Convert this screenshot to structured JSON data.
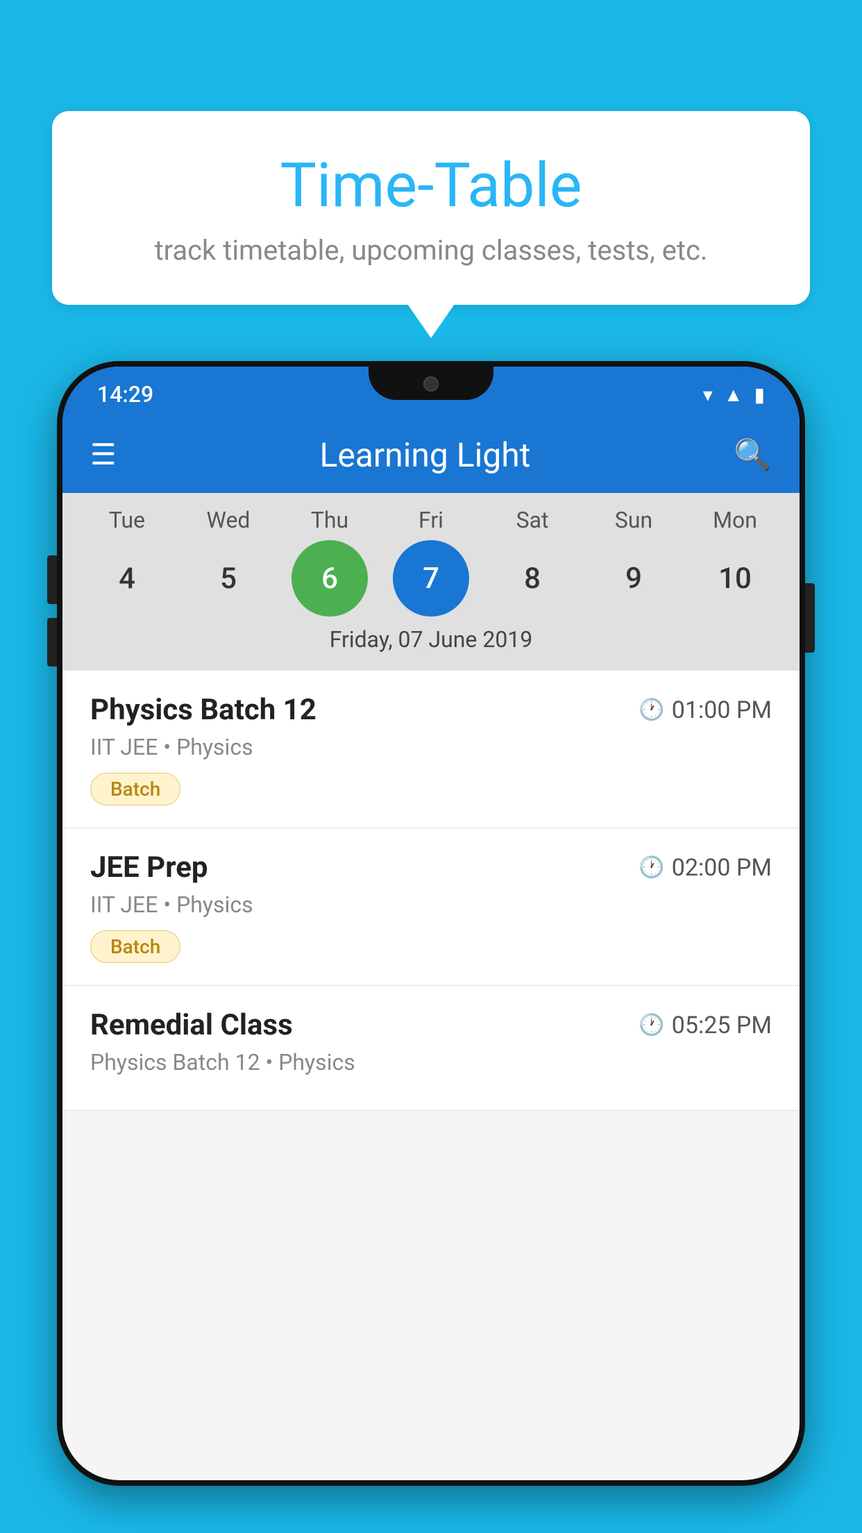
{
  "background_color": "#1ab8e8",
  "bubble": {
    "title": "Time-Table",
    "subtitle": "track timetable, upcoming classes, tests, etc."
  },
  "phone": {
    "status_bar": {
      "time": "14:29"
    },
    "app_bar": {
      "title": "Learning Light"
    },
    "calendar": {
      "days": [
        {
          "label": "Tue",
          "number": "4",
          "state": "normal"
        },
        {
          "label": "Wed",
          "number": "5",
          "state": "normal"
        },
        {
          "label": "Thu",
          "number": "6",
          "state": "today"
        },
        {
          "label": "Fri",
          "number": "7",
          "state": "selected"
        },
        {
          "label": "Sat",
          "number": "8",
          "state": "normal"
        },
        {
          "label": "Sun",
          "number": "9",
          "state": "normal"
        },
        {
          "label": "Mon",
          "number": "10",
          "state": "normal"
        }
      ],
      "selected_date": "Friday, 07 June 2019"
    },
    "schedule": [
      {
        "title": "Physics Batch 12",
        "time": "01:00 PM",
        "subtitle": "IIT JEE • Physics",
        "badge": "Batch"
      },
      {
        "title": "JEE Prep",
        "time": "02:00 PM",
        "subtitle": "IIT JEE • Physics",
        "badge": "Batch"
      },
      {
        "title": "Remedial Class",
        "time": "05:25 PM",
        "subtitle": "Physics Batch 12 • Physics",
        "badge": null
      }
    ]
  }
}
